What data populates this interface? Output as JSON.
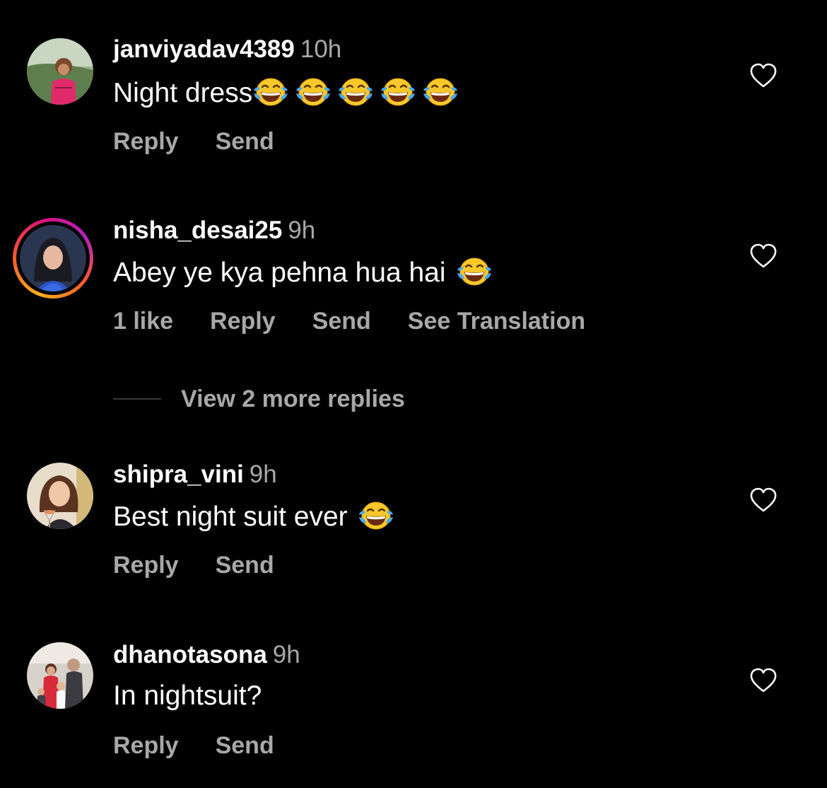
{
  "comments": [
    {
      "username": "janviyadav4389",
      "time": "10h",
      "text": "Night dress",
      "emoji": "face-with-tears-of-joy",
      "emoji_count": 5,
      "actions": [
        "Reply",
        "Send"
      ],
      "story_ring": false
    },
    {
      "username": "nisha_desai25",
      "time": "9h",
      "text": "Abey ye kya pehna hua hai",
      "emoji": "face-with-tears-of-joy",
      "emoji_count": 1,
      "actions": [
        "1 like",
        "Reply",
        "Send",
        "See Translation"
      ],
      "story_ring": true
    },
    {
      "username": "shipra_vini",
      "time": "9h",
      "text": "Best night suit ever",
      "emoji": "face-with-tears-of-joy",
      "emoji_count": 1,
      "actions": [
        "Reply",
        "Send"
      ],
      "story_ring": false
    },
    {
      "username": "dhanotasona",
      "time": "9h",
      "text": "In nightsuit?",
      "emoji": "",
      "emoji_count": 0,
      "actions": [
        "Reply",
        "Send"
      ],
      "story_ring": false
    }
  ],
  "view_more_replies": "View 2 more replies",
  "icons": {
    "like": "heart-outline-icon",
    "emoji": "face-with-tears-of-joy"
  },
  "colors": {
    "background": "#000000",
    "primary_text": "#ffffff",
    "secondary_text": "#a8a8a8",
    "story_ring_start": "#f9b01d",
    "story_ring_end": "#d7137a"
  }
}
